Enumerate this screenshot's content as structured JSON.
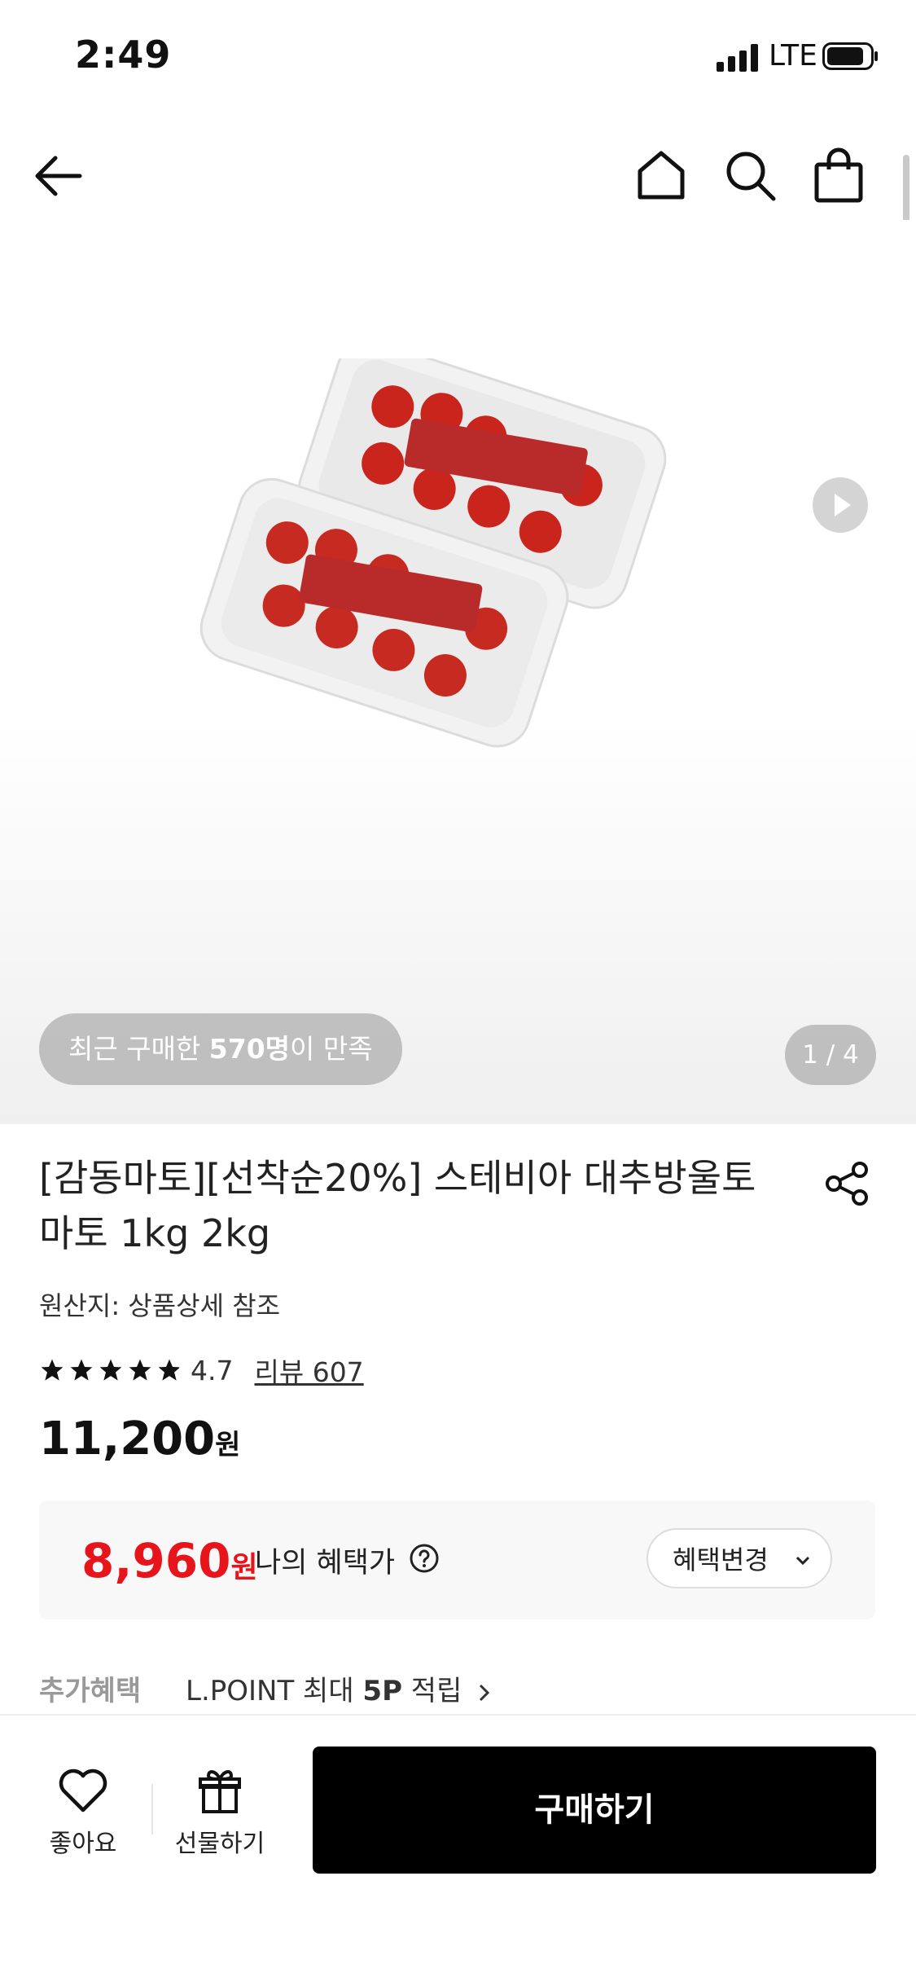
{
  "status_bar": {
    "time": "2:49",
    "network": "LTE"
  },
  "gallery": {
    "satisfaction_prefix": "최근 구매한 ",
    "satisfaction_count": "570명",
    "satisfaction_suffix": "이 만족",
    "page_indicator": "1 / 4"
  },
  "product": {
    "title": "[감동마토][선착순20%] 스테비아 대추방울토마토 1kg 2kg",
    "origin": "원산지: 상품상세 참조",
    "rating": "4.7",
    "review_link": "리뷰 607",
    "rating_stars": 4.7,
    "price": "11,200",
    "price_unit": "원"
  },
  "benefit": {
    "price": "8,960",
    "price_unit": "원",
    "label": "나의 혜택가",
    "change_button": "혜택변경"
  },
  "extra_benefit": {
    "label": "추가혜택",
    "text_prefix": "L.POINT 최대 ",
    "text_bold": "5P",
    "text_suffix": " 적립"
  },
  "bottom_bar": {
    "like_label": "좋아요",
    "gift_label": "선물하기",
    "buy_label": "구매하기"
  },
  "colors": {
    "accent_red": "#e8141c",
    "buy_button": "#000000"
  },
  "icons": [
    "back-arrow-icon",
    "home-icon",
    "search-icon",
    "shopping-bag-icon",
    "play-icon",
    "share-icon",
    "star-icon",
    "question-circle-icon",
    "chevron-down-icon",
    "chevron-right-icon",
    "heart-icon",
    "gift-icon"
  ]
}
